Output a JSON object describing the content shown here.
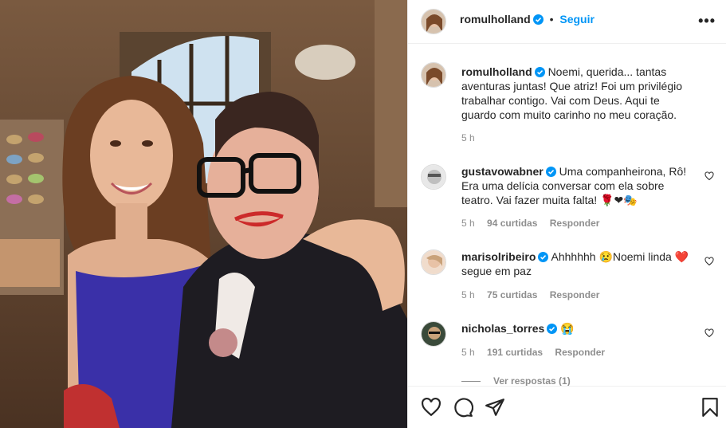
{
  "post": {
    "username": "romulholland",
    "separator": "•",
    "follow_label": "Seguir",
    "more_label": "•••"
  },
  "caption": {
    "username": "romulholland",
    "text": "Noemi, querida... tantas aventuras juntas! Que atriz! Foi um privilégio trabalhar contigo. Vai com Deus. Aqui te guardo com muito carinho no meu coração.",
    "time": "5 h"
  },
  "comments": [
    {
      "username": "gustavowabner",
      "text": "Uma companheirona, Rô! Era uma delícia conversar com ela sobre teatro. Vai fazer muita falta! 🌹❤🎭",
      "time": "5 h",
      "likes": "94 curtidas",
      "reply": "Responder"
    },
    {
      "username": "marisolribeiro",
      "text": "Ahhhhhh 😢Noemi linda ❤️ segue em paz",
      "time": "5 h",
      "likes": "75 curtidas",
      "reply": "Responder"
    },
    {
      "username": "nicholas_torres",
      "text": "😭",
      "time": "5 h",
      "likes": "191 curtidas",
      "reply": "Responder"
    }
  ],
  "view_replies": "Ver respostas (1)",
  "colors": {
    "accent": "#0095f6",
    "text": "#262626",
    "muted": "#8e8e8e",
    "border": "#efefef"
  }
}
